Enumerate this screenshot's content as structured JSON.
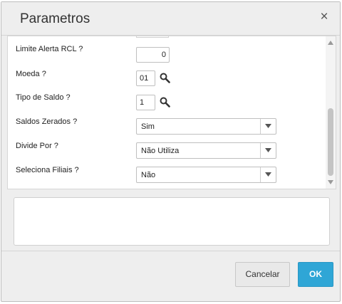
{
  "dialog": {
    "title": "Parametros",
    "close_glyph": "×"
  },
  "params": [
    {
      "label": "Limite Alerta RCL ?",
      "type": "text",
      "value": "0"
    },
    {
      "label": "Moeda ?",
      "type": "lookup",
      "value": "01"
    },
    {
      "label": "Tipo de Saldo ?",
      "type": "lookup",
      "value": "1"
    },
    {
      "label": "Saldos Zerados ?",
      "type": "select",
      "value": "Sim"
    },
    {
      "label": "Divide Por ?",
      "type": "select",
      "value": "Não Utiliza"
    },
    {
      "label": "Seleciona Filiais ?",
      "type": "select",
      "value": "Não"
    }
  ],
  "memo": {
    "value": ""
  },
  "buttons": {
    "cancel_label": "Cancelar",
    "ok_label": "OK"
  },
  "colors": {
    "primary": "#2fa6d6",
    "dialog_bg": "#eeeeee"
  },
  "icons": {
    "close": "close-icon",
    "lookup": "search-icon",
    "dropdown": "chevron-down-icon"
  }
}
